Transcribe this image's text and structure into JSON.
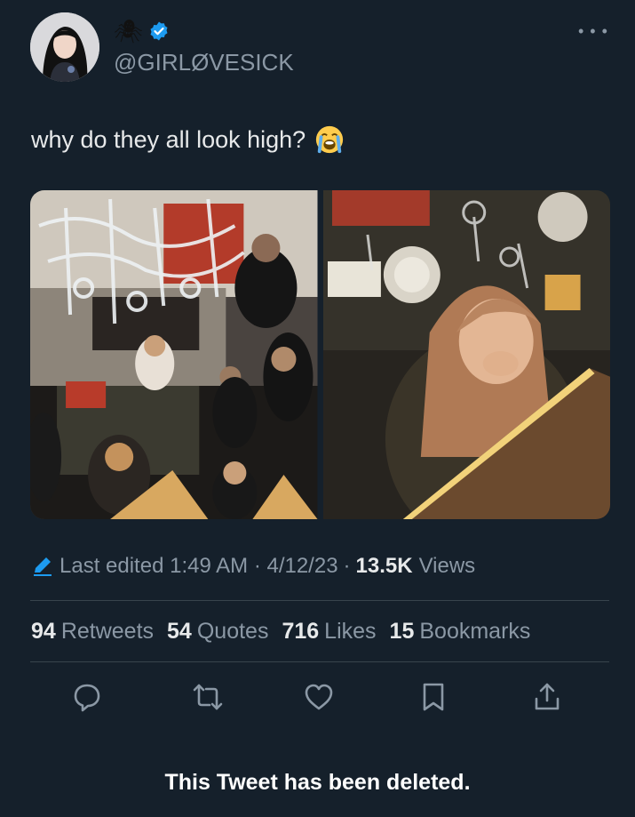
{
  "author": {
    "handle": "@GIRLØVESICK",
    "name_emoji": "🕷",
    "verified": true
  },
  "tweet": {
    "text": "why do they all look high?",
    "emoji": "loudly-crying-face"
  },
  "meta": {
    "edited": "Last edited 1:49 AM · 4/12/23",
    "views_count": "13.5K",
    "views_label": "Views"
  },
  "stats": {
    "retweets_count": "94",
    "retweets_label": "Retweets",
    "quotes_count": "54",
    "quotes_label": "Quotes",
    "likes_count": "716",
    "likes_label": "Likes",
    "bookmarks_count": "15",
    "bookmarks_label": "Bookmarks"
  },
  "actions": [
    "reply-icon",
    "retweet-icon",
    "like-icon",
    "bookmark-icon",
    "share-icon"
  ],
  "notice": "This Tweet has been deleted.",
  "colors": {
    "background": "#15202b",
    "text": "#e7e9ea",
    "secondary": "#8b98a5",
    "verified": "#1d9bf0",
    "divider": "#38444d"
  }
}
